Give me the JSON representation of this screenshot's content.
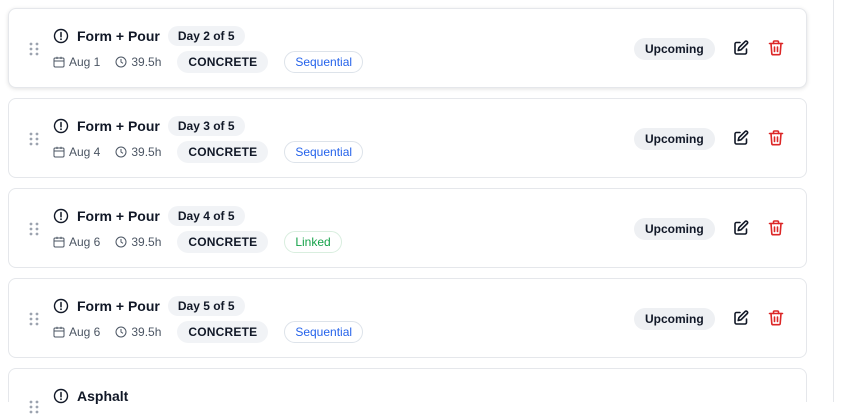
{
  "colors": {
    "delete_icon": "#dc2626",
    "sequential_text": "#2563eb",
    "linked_text": "#16a34a",
    "badge_bg": "#f1f3f6"
  },
  "icons": {
    "drag": "grip-vertical-icon",
    "alert": "alert-circle-icon",
    "date": "calendar-icon",
    "duration": "clock-icon",
    "edit": "edit-icon",
    "delete": "trash-icon"
  },
  "tasks": [
    {
      "title": "Form + Pour",
      "day": "Day 2 of 5",
      "date": "Aug 1",
      "hours": "39.5h",
      "trade": "CONCRETE",
      "link": "Sequential",
      "status": "Upcoming"
    },
    {
      "title": "Form + Pour",
      "day": "Day 3 of 5",
      "date": "Aug 4",
      "hours": "39.5h",
      "trade": "CONCRETE",
      "link": "Sequential",
      "status": "Upcoming"
    },
    {
      "title": "Form + Pour",
      "day": "Day 4 of 5",
      "date": "Aug 6",
      "hours": "39.5h",
      "trade": "CONCRETE",
      "link": "Linked",
      "status": "Upcoming"
    },
    {
      "title": "Form + Pour",
      "day": "Day 5 of 5",
      "date": "Aug 6",
      "hours": "39.5h",
      "trade": "CONCRETE",
      "link": "Sequential",
      "status": "Upcoming"
    },
    {
      "title": "Asphalt"
    }
  ]
}
